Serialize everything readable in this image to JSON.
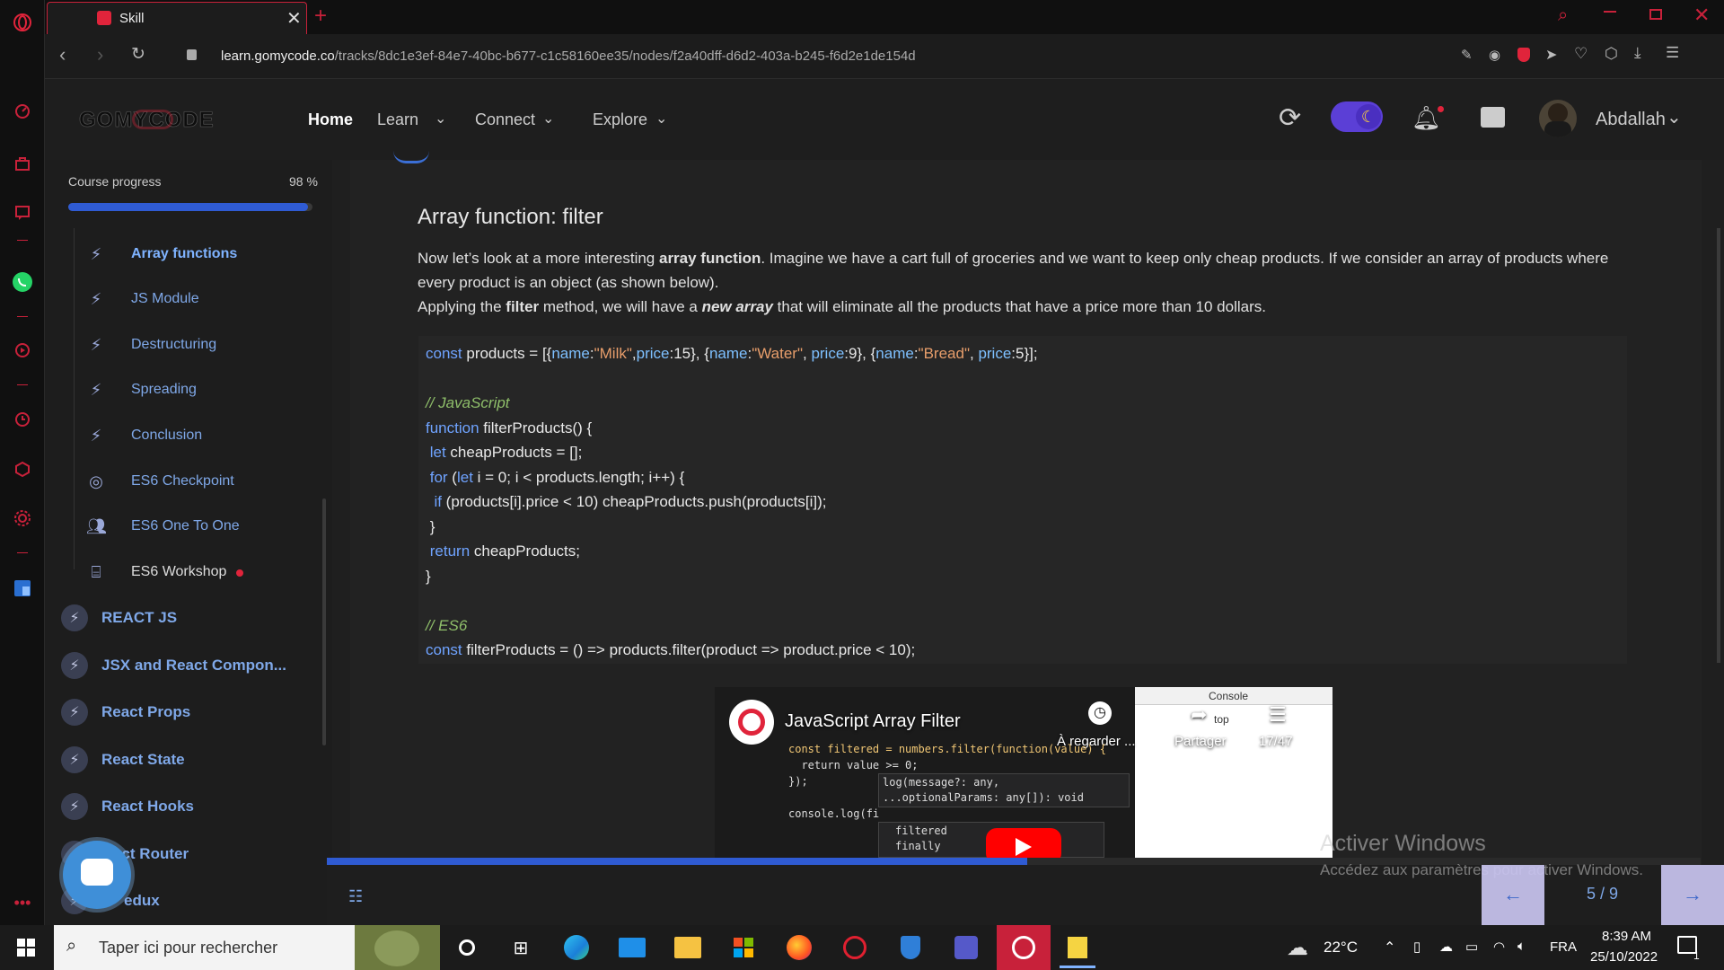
{
  "browser": {
    "tab_title": "Skill",
    "url_host": "learn.gomycode.co",
    "url_path": "/tracks/8dc1e3ef-84e7-40bc-b677-c1c58160ee35/nodes/f2a40dff-d6d2-403a-b245-f6d2e1de154d"
  },
  "header": {
    "logo": "GOMYCODE",
    "nav": [
      "Home",
      "Learn",
      "Connect",
      "Explore"
    ],
    "user_name": "Abdallah"
  },
  "sidebar": {
    "progress_label": "Course progress",
    "progress_percent": 98,
    "progress_text": "98 %",
    "sub_items": [
      {
        "label": "Array functions",
        "icon": "bolt-icon"
      },
      {
        "label": "JS Module",
        "icon": "bolt-icon"
      },
      {
        "label": "Destructuring",
        "icon": "bolt-icon"
      },
      {
        "label": "Spreading",
        "icon": "bolt-icon"
      },
      {
        "label": "Conclusion",
        "icon": "bolt-icon"
      },
      {
        "label": "ES6 Checkpoint",
        "icon": "target-icon"
      },
      {
        "label": "ES6 One To One",
        "icon": "people-icon"
      },
      {
        "label": "ES6 Workshop",
        "icon": "workshop-icon"
      }
    ],
    "modules": [
      {
        "label": "REACT JS"
      },
      {
        "label": "JSX and React Compon..."
      },
      {
        "label": "React Props"
      },
      {
        "label": "React State"
      },
      {
        "label": "React Hooks"
      },
      {
        "label": "act Router"
      },
      {
        "label": "edux"
      }
    ]
  },
  "lesson": {
    "title": "Array function: filter",
    "p1_a": "Now let’s look at a more interesting ",
    "p1_b": "array function",
    "p1_c": ". Imagine we have a cart full of groceries and we want to keep only cheap products. If we consider an array of products where every product is an object (as shown below).",
    "p2_a": "Applying the ",
    "p2_b": "filter",
    "p2_c": " method, we will have a ",
    "p2_d": "new array",
    "p2_e": " that will eliminate all the products that have a price more than 10 dollars."
  },
  "code": {
    "line1": "const products = [{name:\"Milk\",price:15}, {name:\"Water\", price:9}, {name:\"Bread\", price:5}];",
    "comment_js": "// JavaScript",
    "line_fn": "function filterProducts() {",
    "line_let": " let cheapProducts = [];",
    "line_for": " for (let i = 0; i < products.length; i++) {",
    "line_if": "  if (products[i].price < 10) cheapProducts.push(products[i]);",
    "line_close1": " }",
    "line_return": " return cheapProducts;",
    "line_close2": "}",
    "comment_es6": "// ES6",
    "line_es6": "const filterProducts = () => products.filter(product => product.price < 10);"
  },
  "video": {
    "title": "JavaScript Array Filter",
    "watch_later": "À regarder ...",
    "share": "Partager",
    "counter": "17/47",
    "console_tab": "Console",
    "top_label": "top",
    "code1": "const filtered = numbers.filter(function(value) {",
    "code2": "  return value >= 0;",
    "code3": "});",
    "code4": "console.log(fi",
    "hint1": "log(message?: any,",
    "hint2": "...optionalParams: any[]): void",
    "sugg1": "filtered",
    "sugg2": "finally"
  },
  "footer": {
    "page_indicator": "5 / 9",
    "activate_title": "Activer Windows",
    "activate_sub": "Accédez aux paramètres pour activer Windows."
  },
  "taskbar": {
    "search_placeholder": "Taper ici pour rechercher",
    "temperature": "22°C",
    "language": "FRA",
    "time": "8:39 AM",
    "date": "25/10/2022",
    "notif_count": "1"
  }
}
